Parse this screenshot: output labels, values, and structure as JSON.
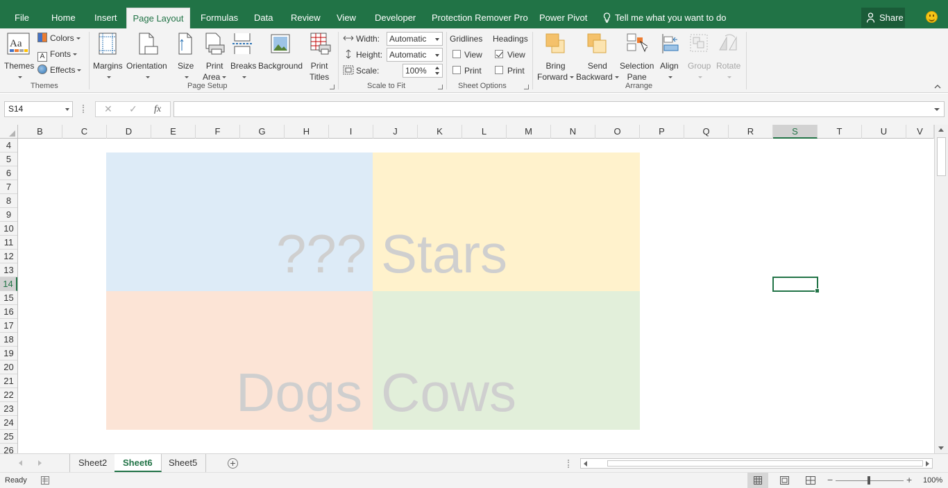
{
  "tabs": {
    "file": "File",
    "home": "Home",
    "insert": "Insert",
    "page_layout": "Page Layout",
    "formulas": "Formulas",
    "data": "Data",
    "review": "Review",
    "view": "View",
    "developer": "Developer",
    "protection": "Protection Remover Pro",
    "power_pivot": "Power Pivot",
    "tell_me": "Tell me what you want to do",
    "share": "Share"
  },
  "ribbon": {
    "themes": {
      "themes": "Themes",
      "colors": "Colors",
      "fonts": "Fonts",
      "effects": "Effects",
      "group": "Themes"
    },
    "page_setup": {
      "margins": "Margins",
      "orientation": "Orientation",
      "size": "Size",
      "print_area_1": "Print",
      "print_area_2": "Area",
      "breaks": "Breaks",
      "background": "Background",
      "print_titles_1": "Print",
      "print_titles_2": "Titles",
      "group": "Page Setup"
    },
    "scale": {
      "width_label": "Width:",
      "width_value": "Automatic",
      "height_label": "Height:",
      "height_value": "Automatic",
      "scale_label": "Scale:",
      "scale_value": "100%",
      "group": "Scale to Fit"
    },
    "sheet_options": {
      "gridlines": "Gridlines",
      "headings": "Headings",
      "view": "View",
      "print": "Print",
      "group": "Sheet Options",
      "gridlines_view": false,
      "gridlines_print": false,
      "headings_view": true,
      "headings_print": false
    },
    "arrange": {
      "bring_1": "Bring",
      "bring_2": "Forward",
      "send_1": "Send",
      "send_2": "Backward",
      "selection_1": "Selection",
      "selection_2": "Pane",
      "align": "Align",
      "group_btn": "Group",
      "rotate": "Rotate",
      "group": "Arrange"
    }
  },
  "formula_bar": {
    "name_box": "S14",
    "cancel": "✕",
    "enter": "✓",
    "fx": "fx",
    "formula": ""
  },
  "columns": [
    "B",
    "C",
    "D",
    "E",
    "F",
    "G",
    "H",
    "I",
    "J",
    "K",
    "L",
    "M",
    "N",
    "O",
    "P",
    "Q",
    "R",
    "S",
    "T",
    "U",
    "V"
  ],
  "rows": [
    "4",
    "5",
    "6",
    "7",
    "8",
    "9",
    "10",
    "11",
    "12",
    "13",
    "14",
    "15",
    "16",
    "17",
    "18",
    "19",
    "20",
    "21",
    "22",
    "23",
    "24",
    "25",
    "26"
  ],
  "selected_column": "S",
  "selected_row": "14",
  "quadrants": {
    "top_left_text": "???",
    "top_right_text": "Stars",
    "bottom_left_text": "Dogs",
    "bottom_right_text": "Cows",
    "colors": {
      "top_left": "#ddebf7",
      "top_right": "#fff2cc",
      "bottom_left": "#fce4d6",
      "bottom_right": "#e2efda"
    }
  },
  "sheets": {
    "sheet2": "Sheet2",
    "sheet6": "Sheet6",
    "sheet5": "Sheet5",
    "active": "Sheet6"
  },
  "status": {
    "ready": "Ready",
    "zoom": "100%"
  }
}
